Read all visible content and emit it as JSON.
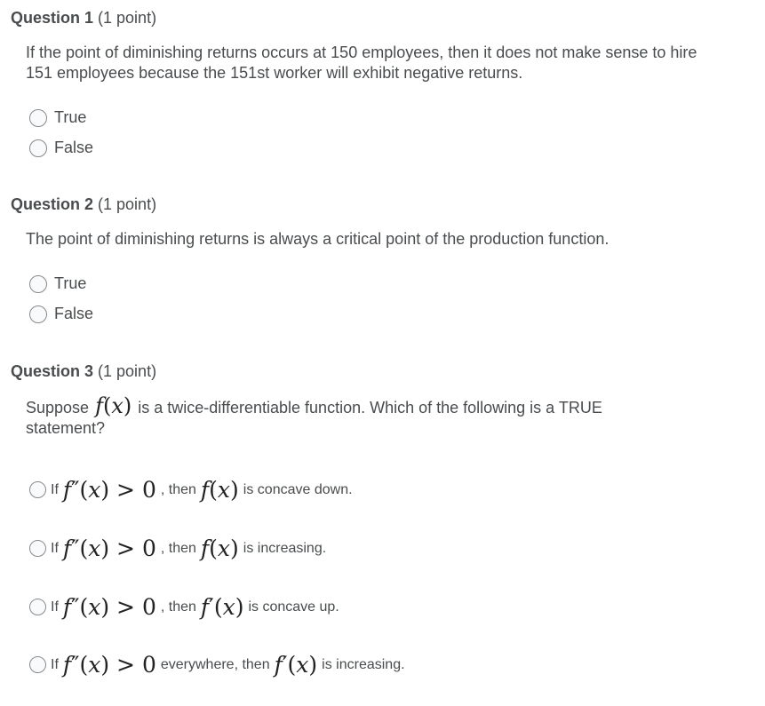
{
  "questions": [
    {
      "number_label": "Question 1",
      "points_label": "(1 point)",
      "text": "If the point of diminishing returns occurs at 150 employees, then it does not make sense to hire 151 employees because the 151st worker will exhibit negative returns.",
      "options": [
        {
          "label": "True",
          "selected": false
        },
        {
          "label": "False",
          "selected": false
        }
      ]
    },
    {
      "number_label": "Question 2",
      "points_label": "(1 point)",
      "text": "The point of diminishing returns is always a critical point of the production function.",
      "options": [
        {
          "label": "True",
          "selected": false
        },
        {
          "label": "False",
          "selected": false
        }
      ]
    },
    {
      "number_label": "Question 3",
      "points_label": "(1 point)",
      "text_prefix": "Suppose",
      "text_math": "f(x)",
      "text_suffix": "is a twice-differentiable function. Which of the following is a TRUE statement?",
      "options": [
        {
          "if": "If",
          "cond": "f″(x) > 0",
          "mid": ", then",
          "subject": "f(x)",
          "tail": "is concave down.",
          "selected": false
        },
        {
          "if": "If",
          "cond": "f″(x) > 0",
          "mid": ", then",
          "subject": "f(x)",
          "tail": "is increasing.",
          "selected": false
        },
        {
          "if": "If",
          "cond": "f″(x) > 0",
          "mid": ", then",
          "subject": "f′(x)",
          "tail": "is concave up.",
          "selected": false
        },
        {
          "if": "If",
          "cond": "f″(x) > 0",
          "mid": "everywhere, then",
          "subject": "f′(x)",
          "tail": "is increasing.",
          "selected": false
        }
      ]
    }
  ]
}
